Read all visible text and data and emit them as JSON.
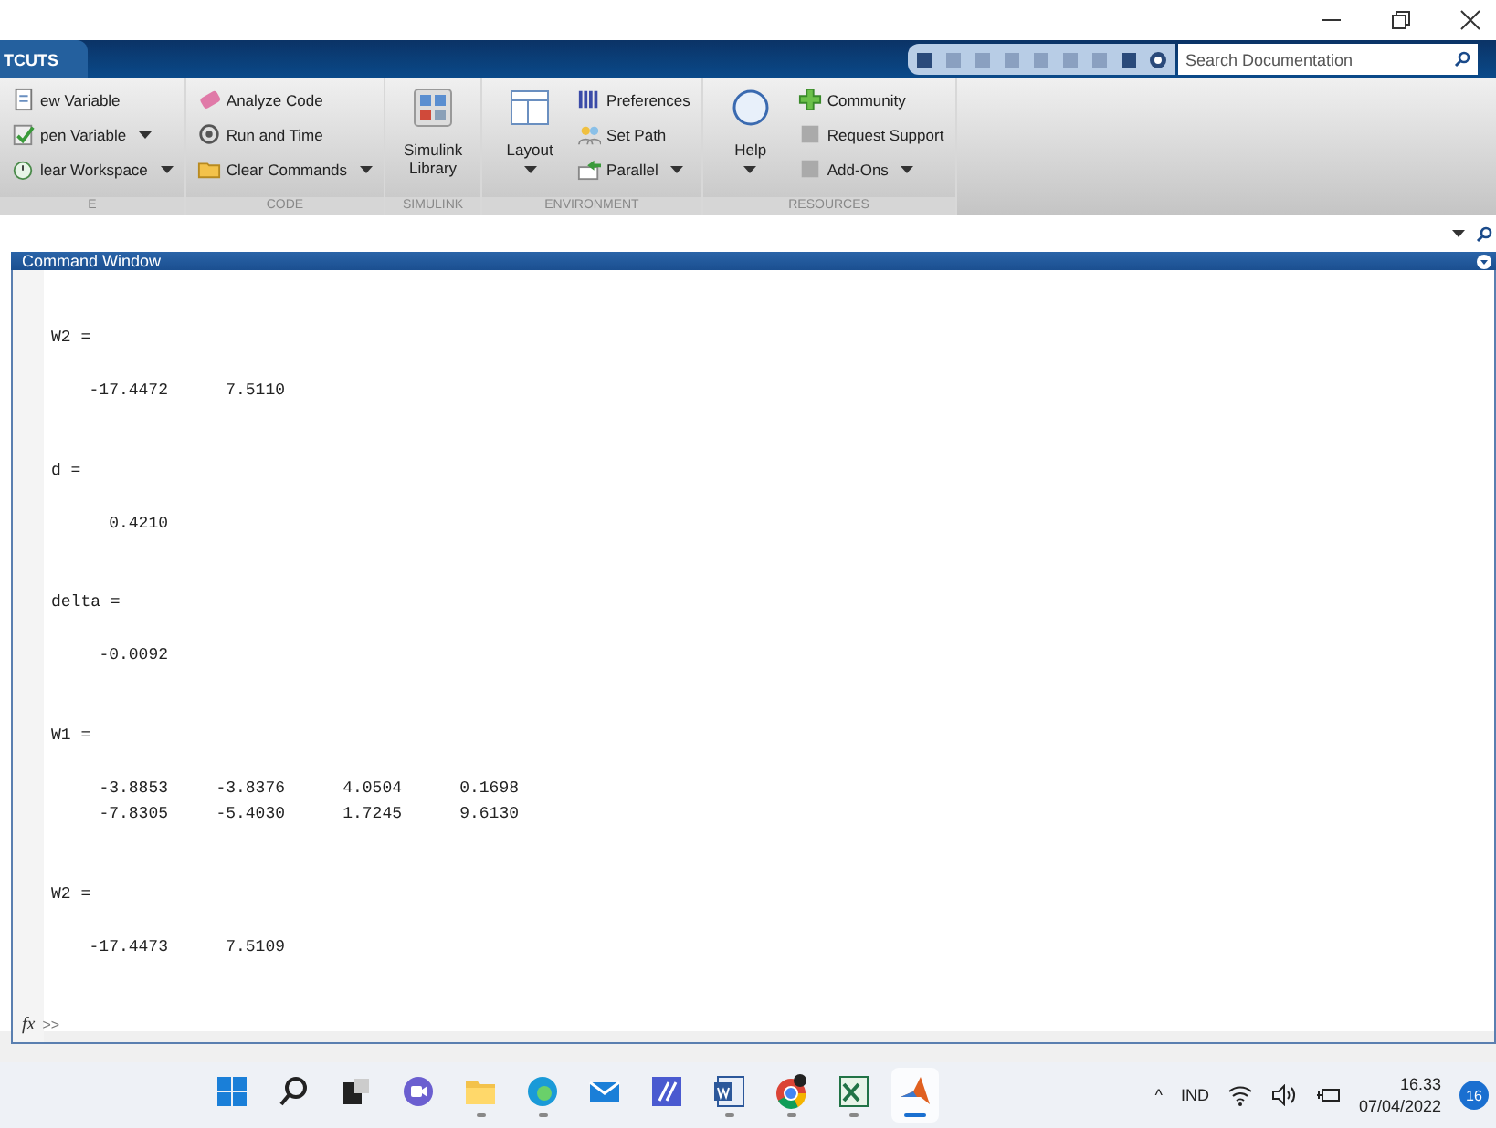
{
  "tab": {
    "label": "TCUTS",
    "selected": true
  },
  "search": {
    "placeholder": "Search Documentation"
  },
  "ribbon": [
    {
      "label": "E",
      "items": [
        {
          "kind": "small",
          "label": "ew Variable",
          "dropdown": false
        },
        {
          "kind": "small",
          "label": "pen Variable",
          "dropdown": true
        },
        {
          "kind": "small",
          "label": "lear Workspace",
          "dropdown": true
        }
      ]
    },
    {
      "label": "CODE",
      "items": [
        {
          "kind": "small",
          "label": "Analyze Code",
          "dropdown": false
        },
        {
          "kind": "small",
          "label": "Run and Time",
          "dropdown": false
        },
        {
          "kind": "small",
          "label": "Clear Commands",
          "dropdown": true
        }
      ]
    },
    {
      "label": "SIMULINK",
      "items": [
        {
          "kind": "large",
          "label": "Simulink Library",
          "dropdown": false
        }
      ]
    },
    {
      "label": "ENVIRONMENT",
      "items": [
        {
          "kind": "large",
          "label": "Layout",
          "dropdown": true
        },
        {
          "kind": "small",
          "label": "Preferences",
          "dropdown": false
        },
        {
          "kind": "small",
          "label": "Set Path",
          "dropdown": false
        },
        {
          "kind": "small",
          "label": "Parallel",
          "dropdown": true
        }
      ]
    },
    {
      "label": "RESOURCES",
      "items": [
        {
          "kind": "large",
          "label": "Help",
          "dropdown": true
        },
        {
          "kind": "small",
          "label": "Community",
          "dropdown": false
        },
        {
          "kind": "small",
          "label": "Request Support",
          "dropdown": false
        },
        {
          "kind": "small",
          "label": "Add-Ons",
          "dropdown": true
        }
      ]
    }
  ],
  "command_window": {
    "title": "Command Window",
    "outputs": [
      {
        "header": "W2 =",
        "rows": [
          [
            "-17.4472",
            "7.5110"
          ]
        ]
      },
      {
        "header": "d =",
        "rows": [
          [
            "0.4210"
          ]
        ]
      },
      {
        "header": "delta =",
        "rows": [
          [
            "-0.0092"
          ]
        ]
      },
      {
        "header": "W1 =",
        "rows": [
          [
            "-3.8853",
            "-3.8376",
            "4.0504",
            "0.1698"
          ],
          [
            "-7.8305",
            "-5.4030",
            "1.7245",
            "9.6130"
          ]
        ]
      },
      {
        "header": "W2 =",
        "rows": [
          [
            "-17.4473",
            "7.5109"
          ]
        ]
      }
    ],
    "function_label": "fx",
    "prompt": ">>"
  },
  "taskbar": {
    "apps": [
      {
        "running": false,
        "selected": false
      },
      {
        "running": false,
        "selected": false
      },
      {
        "running": false,
        "selected": false
      },
      {
        "running": false,
        "selected": false
      },
      {
        "running": true,
        "selected": false
      },
      {
        "running": true,
        "selected": false
      },
      {
        "running": false,
        "selected": false
      },
      {
        "running": false,
        "selected": false
      },
      {
        "running": true,
        "selected": false
      },
      {
        "running": true,
        "selected": false
      },
      {
        "running": true,
        "selected": false
      },
      {
        "running": true,
        "selected": true
      }
    ],
    "tray_arrow": "^",
    "language": "IND",
    "time": "16.33",
    "date": "07/04/2022",
    "notifications": "16"
  }
}
